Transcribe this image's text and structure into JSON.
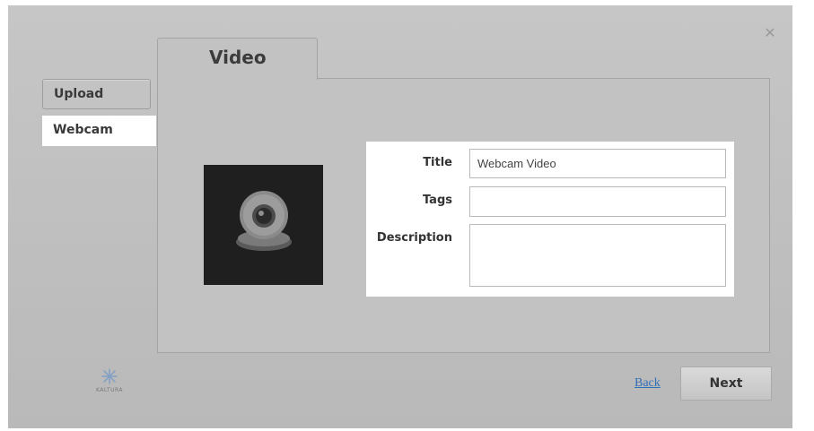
{
  "dialog": {
    "close_symbol": "✕"
  },
  "sidebar": {
    "tabs": [
      {
        "label": "Upload"
      },
      {
        "label": "Webcam"
      }
    ]
  },
  "panel": {
    "tab_title": "Video"
  },
  "form": {
    "title_label": "Title",
    "title_value": "Webcam Video",
    "tags_label": "Tags",
    "tags_value": "",
    "description_label": "Description",
    "description_value": ""
  },
  "footer": {
    "logo_text": "KALTURA",
    "back_label": "Back",
    "next_label": "Next"
  },
  "icons": {
    "webcam": "webcam-icon",
    "close": "close-icon",
    "logo": "kaltura-logo-icon"
  }
}
